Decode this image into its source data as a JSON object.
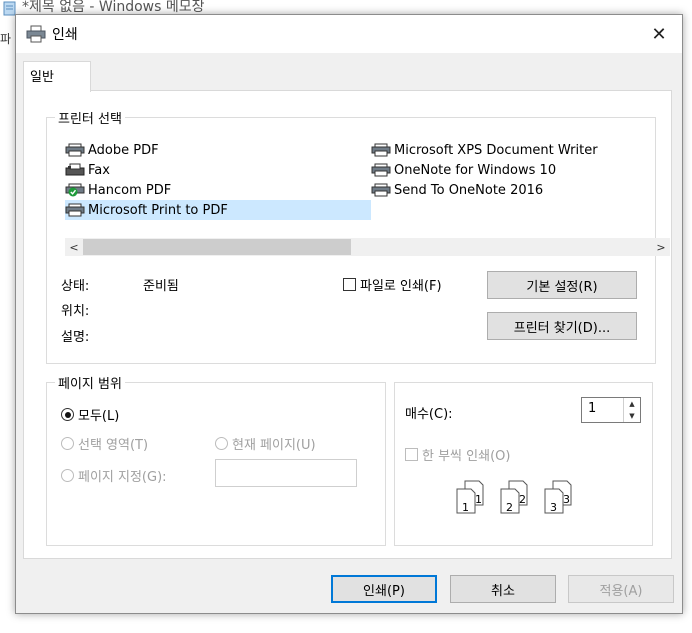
{
  "background_window": {
    "title": "*제목 없음 - Windows 메모장",
    "menu_fragment": "파"
  },
  "dialog": {
    "title": "인쇄",
    "close_glyph": "✕",
    "tab_label": "일반"
  },
  "printer_group": {
    "label": "프린터 선택",
    "printers_left": [
      "Adobe PDF",
      "Fax",
      "Hancom PDF",
      "Microsoft Print to PDF"
    ],
    "printers_right": [
      "Microsoft XPS Document Writer",
      "OneNote for Windows 10",
      "Send To OneNote 2016"
    ],
    "selected": "Microsoft Print to PDF",
    "scroll_left": "<",
    "scroll_right": ">",
    "status_label": "상태:",
    "status_value": "준비됨",
    "location_label": "위치:",
    "comment_label": "설명:",
    "print_to_file": "파일로 인쇄(F)",
    "preferences_button": "기본 설정(R)",
    "find_printer_button": "프린터 찾기(D)..."
  },
  "page_range": {
    "label": "페이지 범위",
    "all": "모두(L)",
    "selection": "선택 영역(T)",
    "current_page": "현재 페이지(U)",
    "pages": "페이지 지정(G):",
    "pages_value": ""
  },
  "copies": {
    "label": "매수(C):",
    "value": "1",
    "collate": "한 부씩 인쇄(O)",
    "collate_pages": [
      "1",
      "1",
      "2",
      "2",
      "3",
      "3"
    ]
  },
  "footer": {
    "print_button": "인쇄(P)",
    "cancel_button": "취소",
    "apply_button": "적용(A)"
  },
  "colors": {
    "selection": "#cce8ff",
    "default_button_border": "#0078d7",
    "dialog_bg": "#f0f0f0"
  }
}
